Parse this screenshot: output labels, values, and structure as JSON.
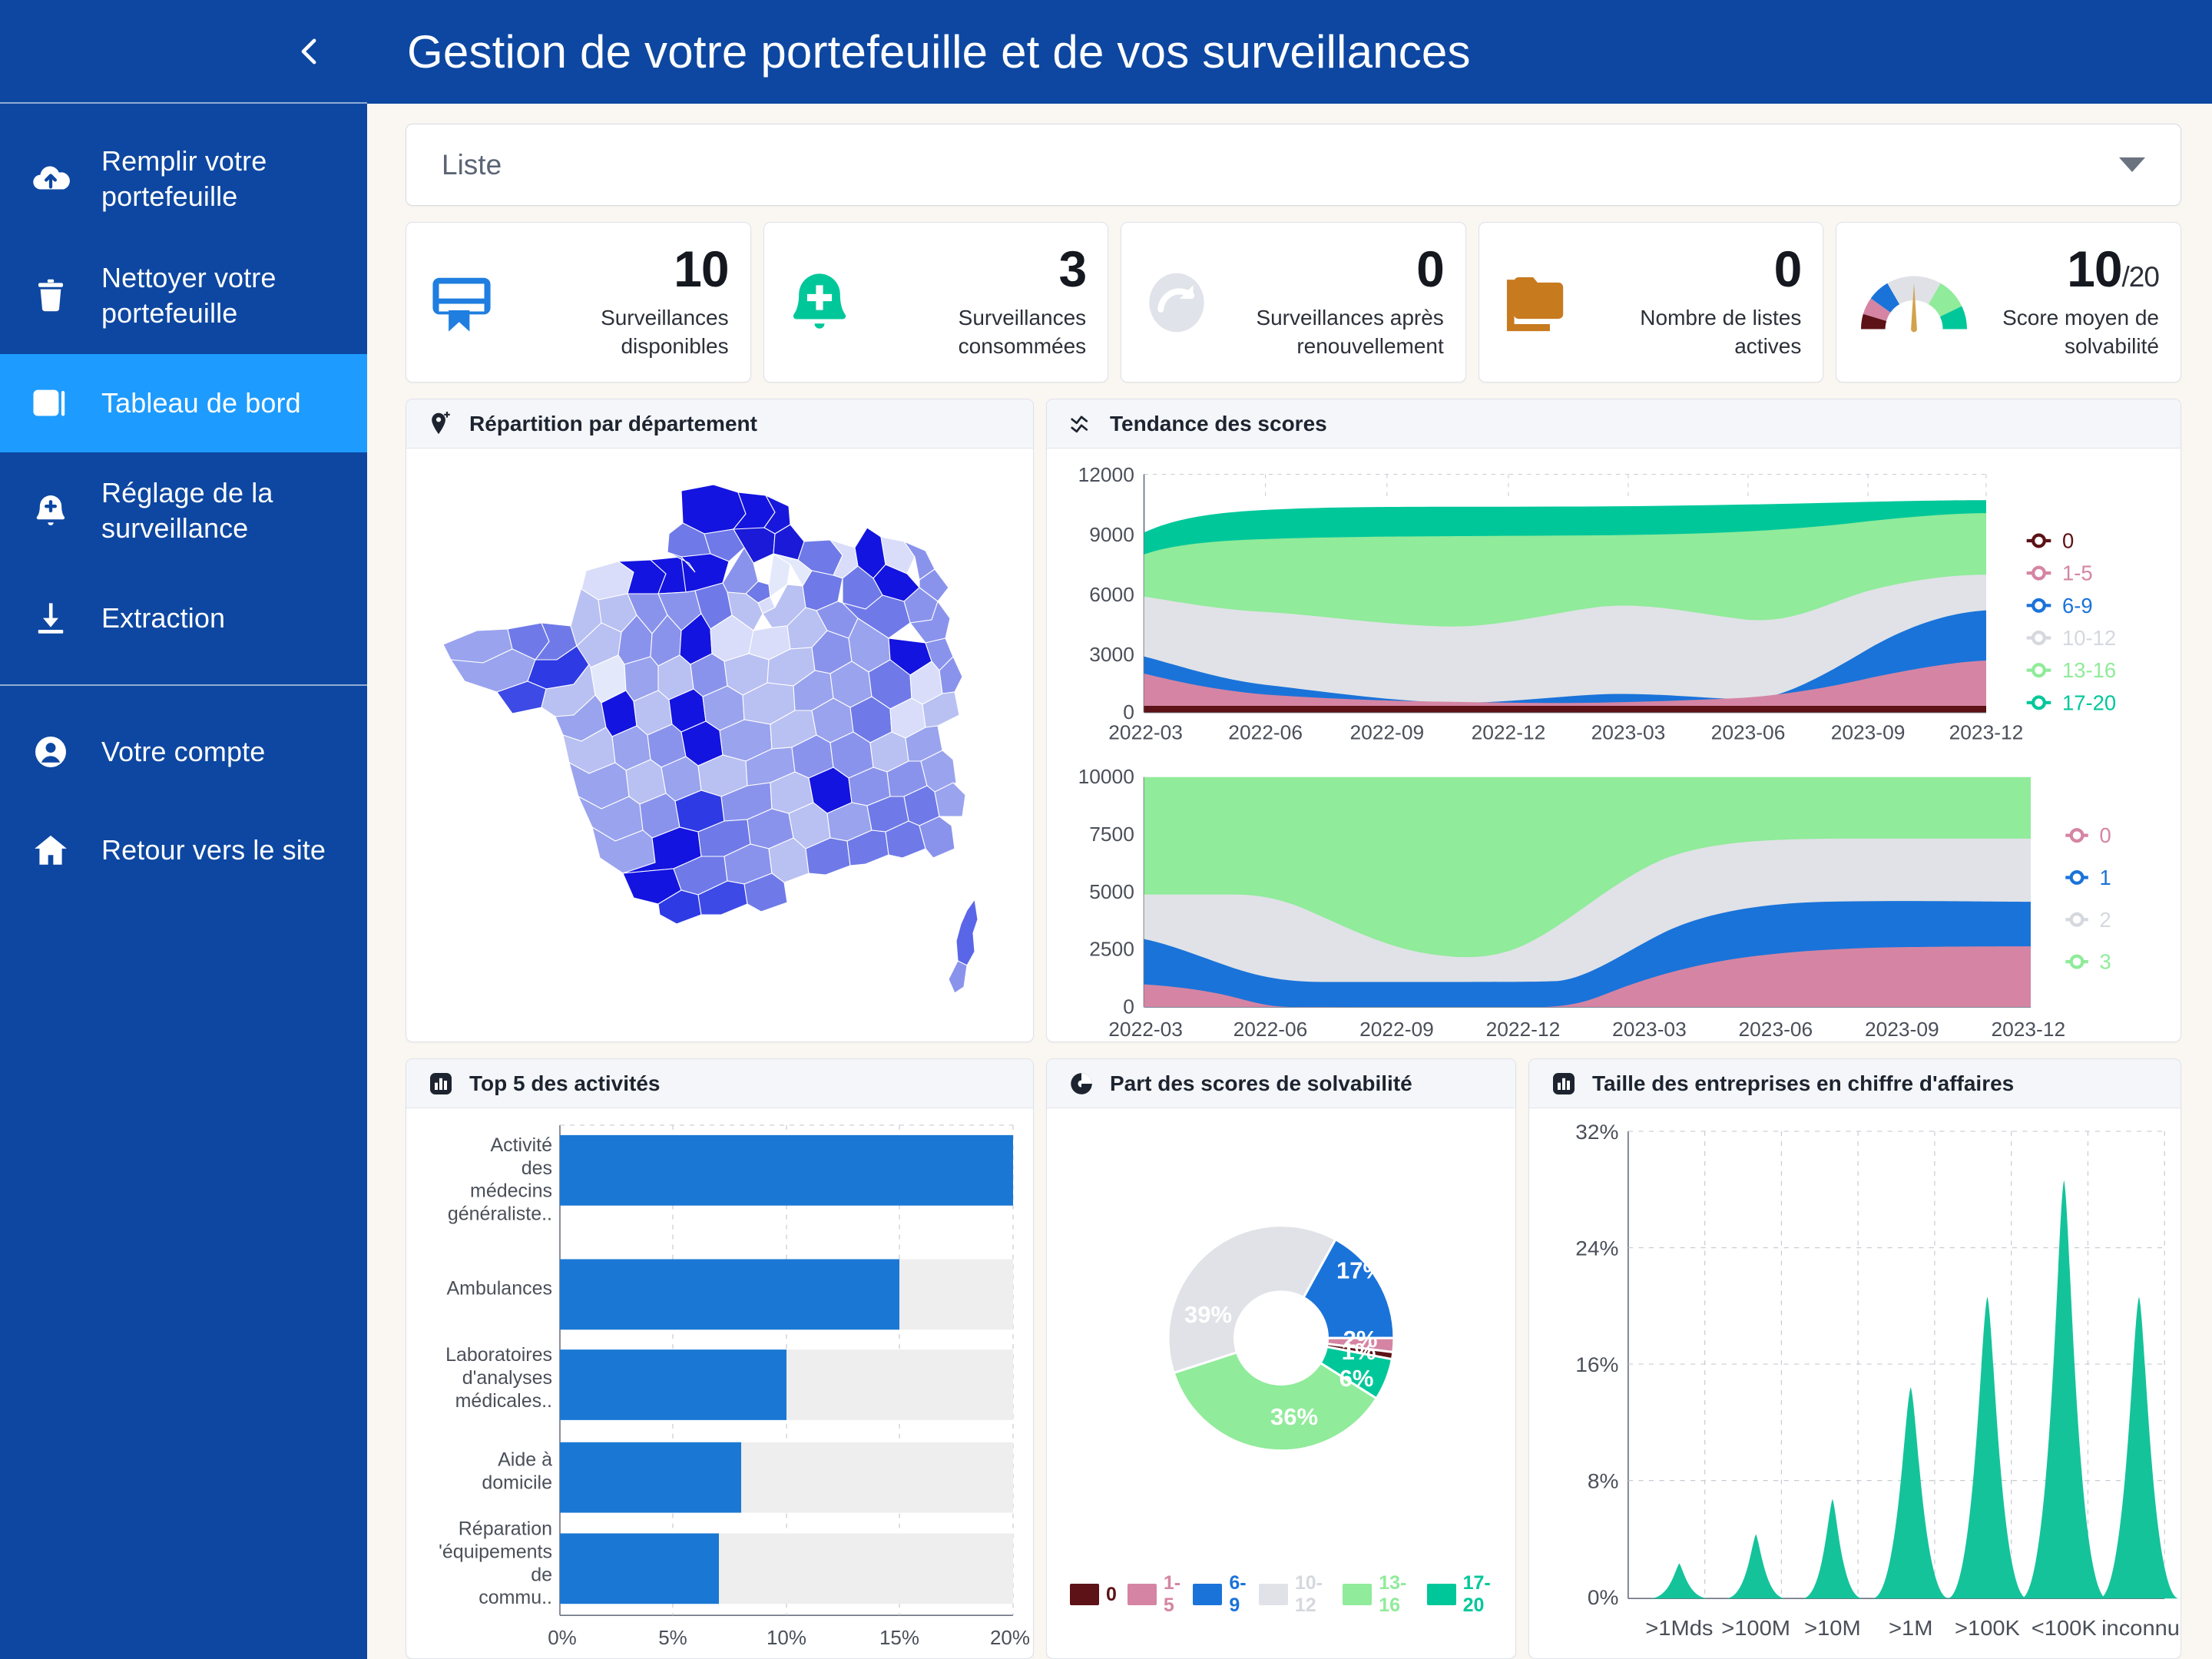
{
  "app": {
    "header_title": "Gestion de votre portefeuille et de vos surveillances",
    "collapse_icon": "chevron-left-icon"
  },
  "sidebar": {
    "groups": [
      {
        "items": [
          {
            "label": "Remplir votre portefeuille",
            "icon": "cloud-upload-icon",
            "active": false
          },
          {
            "label": "Nettoyer votre portefeuille",
            "icon": "trash-icon",
            "active": false
          },
          {
            "label": "Tableau de bord",
            "icon": "dashboard-icon",
            "active": true
          },
          {
            "label": "Réglage de la surveillance",
            "icon": "bell-plus-icon",
            "active": false
          },
          {
            "label": "Extraction",
            "icon": "download-icon",
            "active": false
          }
        ]
      },
      {
        "items": [
          {
            "label": "Votre compte",
            "icon": "user-circle-icon",
            "active": false
          },
          {
            "label": "Retour vers le site",
            "icon": "home-icon",
            "active": false
          }
        ]
      }
    ]
  },
  "filter": {
    "selected": "Liste",
    "caret_icon": "chevron-down-icon"
  },
  "kpis": [
    {
      "value": "10",
      "suffix": "",
      "label": "Surveillances disponibles",
      "icon": "bookmark-card-icon",
      "color": "#1f7ee0"
    },
    {
      "value": "3",
      "suffix": "",
      "label": "Surveillances consommées",
      "icon": "bell-plus-icon",
      "color": "#00c79a"
    },
    {
      "value": "0",
      "suffix": "",
      "label": "Surveillances après renouvellement",
      "icon": "renew-arrow-icon",
      "color": "#dfe1e8"
    },
    {
      "value": "0",
      "suffix": "",
      "label": "Nombre de listes actives",
      "icon": "folders-icon",
      "color": "#c87a1e"
    },
    {
      "value": "10",
      "suffix": "/20",
      "label": "Score moyen de solvabilité",
      "icon": "gauge-icon",
      "color": "#d2a24c"
    }
  ],
  "panels": {
    "map": {
      "title": "Répartition par département",
      "icon": "map-pin-plus-icon"
    },
    "trend": {
      "title": "Tendance des scores",
      "icon": "trend-line-icon"
    },
    "top5": {
      "title": "Top 5 des activités",
      "icon": "bar-chart-icon"
    },
    "donut": {
      "title": "Part des scores de solvabilité",
      "icon": "pie-chart-icon"
    },
    "size": {
      "title": "Taille des entreprises en chiffre d'affaires",
      "icon": "bar-chart-icon"
    }
  },
  "palette": {
    "score_0": "#5c1216",
    "score_1_5": "#d585a3",
    "score_6_9": "#1a73d9",
    "score_10_12": "#e0e2e7",
    "score_13_16": "#90eb9a",
    "score_17_20": "#00c79a",
    "bar_blue": "#1a78d4",
    "bar_track": "#eeeeee",
    "teal": "#15c39a",
    "brand_blue": "#0d47a1",
    "active_blue": "#1e9bff"
  },
  "chart_data": [
    {
      "type": "area",
      "id": "tendance-des-scores-top",
      "title": "Tendance des scores",
      "stacked": true,
      "x": [
        "2022-03",
        "2022-06",
        "2022-09",
        "2022-12",
        "2023-03",
        "2023-06",
        "2023-09",
        "2023-12"
      ],
      "xlabel": "",
      "ylabel": "",
      "ylim": [
        0,
        12000
      ],
      "yticks": [
        0,
        3000,
        6000,
        9000,
        12000
      ],
      "grid": true,
      "legend_position": "right",
      "series": [
        {
          "name": "0",
          "color": "#5c1216",
          "values": [
            330,
            330,
            330,
            330,
            330,
            330,
            330,
            330
          ]
        },
        {
          "name": "1-5",
          "color": "#d585a3",
          "values": [
            1600,
            1000,
            780,
            820,
            500,
            700,
            1500,
            1650
          ]
        },
        {
          "name": "6-9",
          "color": "#1a73d9",
          "values": [
            2600,
            2400,
            1380,
            1320,
            1620,
            1630,
            3000,
            3140
          ]
        },
        {
          "name": "10-12",
          "color": "#e0e2e7",
          "values": [
            2990,
            3640,
            3900,
            3880,
            3890,
            3900,
            2900,
            3000
          ]
        },
        {
          "name": "13-16",
          "color": "#90eb9a",
          "values": [
            2130,
            2570,
            3530,
            3580,
            3400,
            3370,
            2600,
            1880
          ]
        },
        {
          "name": "17-20",
          "color": "#00c79a",
          "values": [
            1090,
            630,
            430,
            420,
            430,
            430,
            430,
            460
          ]
        }
      ]
    },
    {
      "type": "area",
      "id": "tendance-des-scores-bottom",
      "title": "",
      "stacked": true,
      "x": [
        "2022-03",
        "2022-06",
        "2022-09",
        "2022-12",
        "2023-03",
        "2023-06",
        "2023-09",
        "2023-12"
      ],
      "xlabel": "",
      "ylabel": "",
      "ylim": [
        0,
        10000
      ],
      "yticks": [
        0,
        2500,
        5000,
        7500,
        10000
      ],
      "grid": false,
      "legend_position": "right",
      "series": [
        {
          "name": "0",
          "color": "#d585a3",
          "values": [
            1000,
            900,
            0,
            0,
            0,
            1500,
            2000,
            2050
          ]
        },
        {
          "name": "1",
          "color": "#1a73d9",
          "values": [
            1950,
            1450,
            1100,
            1100,
            1100,
            1250,
            2450,
            2400
          ]
        },
        {
          "name": "2",
          "color": "#e0e2e7",
          "values": [
            2150,
            2650,
            2900,
            2200,
            1800,
            2450,
            2550,
            2550
          ]
        },
        {
          "name": "3",
          "color": "#90eb9a",
          "values": [
            4900,
            5000,
            6000,
            6700,
            7100,
            4800,
            3000,
            3000
          ]
        }
      ]
    },
    {
      "type": "bar",
      "id": "top-5-des-activites",
      "title": "Top 5 des activités",
      "orientation": "horizontal",
      "categories": [
        "Activité des médecins généraliste..",
        "Ambulances",
        "Laboratoires d'analyses médicales..",
        "Aide à domicile",
        "Réparation d'équipements de commu.."
      ],
      "values": [
        20,
        15,
        10,
        8,
        7
      ],
      "unit": "%",
      "xlabel": "",
      "ylabel": "",
      "xlim": [
        0,
        20
      ],
      "xticks": [
        "0%",
        "5%",
        "10%",
        "15%",
        "20%"
      ],
      "bar_color": "#1a78d4",
      "track_color": "#eeeeee"
    },
    {
      "type": "pie",
      "id": "part-des-scores-de-solvabilite",
      "title": "Part des scores de solvabilité",
      "donut": true,
      "labels": [
        "0",
        "1-5",
        "6-9",
        "10-12",
        "13-16",
        "17-20"
      ],
      "values": [
        1,
        2,
        17,
        39,
        36,
        6
      ],
      "display_labels": [
        "1%",
        "2%",
        "17%",
        "39%",
        "36%",
        "6%"
      ],
      "colors": [
        "#5c1216",
        "#d585a3",
        "#1a73d9",
        "#e0e2e7",
        "#90eb9a",
        "#00c79a"
      ],
      "legend_position": "bottom"
    },
    {
      "type": "area",
      "id": "taille-des-entreprises-en-chiffre-daffaires",
      "title": "Taille des entreprises en chiffre d'affaires",
      "categories": [
        ">1Mds",
        ">100M",
        ">10M",
        ">1M",
        ">100K",
        "<100K",
        "inconnu"
      ],
      "values": [
        2.4,
        4.2,
        6.4,
        14.2,
        20.2,
        29.5,
        20.0
      ],
      "unit": "%",
      "ylim": [
        0,
        32
      ],
      "yticks": [
        "0%",
        "8%",
        "16%",
        "24%",
        "32%"
      ],
      "grid": true,
      "color": "#15c39a"
    }
  ]
}
